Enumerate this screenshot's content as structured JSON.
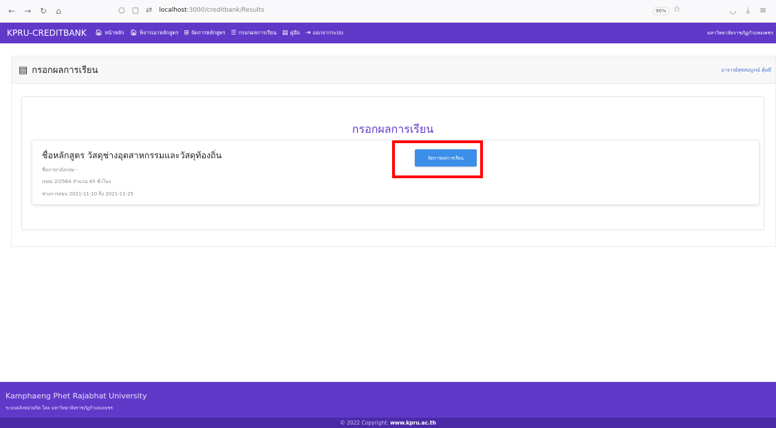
{
  "browser": {
    "url_host": "localhost",
    "url_path": ":3000/creditbank/Results",
    "zoom": "90%"
  },
  "navbar": {
    "brand": "KPRU-CREDITBANK",
    "items": [
      {
        "label": "หน้าหลัก",
        "icon": "home-icon"
      },
      {
        "label": "พิจารณาหลักสูตร",
        "icon": "home-icon"
      },
      {
        "label": "จัดการหลักสูตร",
        "icon": "plus-square-icon"
      },
      {
        "label": "กรอกผลการเรียน",
        "icon": "list-icon"
      },
      {
        "label": "คู่มือ",
        "icon": "book-icon"
      },
      {
        "label": "ออกจากระบบ",
        "icon": "sign-out-icon"
      }
    ],
    "university": "มหาวิทยาลัยราชภัฏกำแพงเพชร"
  },
  "page": {
    "title": "กรอกผลการเรียน",
    "user": "อาจารย์สุขสมบูรณ์ ตุ้มมี"
  },
  "card": {
    "title": "กรอกผลการเรียน",
    "course_name": "ชื่อหลักสูตร วัสดุช่างอุตสาหกรรมและวัสดุท้องถิ่น",
    "course_en": "ชื่อภาษาอังกฤษ -",
    "term": "เทอม 2/2564 จำนวน 45 ชั่วโมง",
    "period": "ช่วงการสอน 2021-11-10 ถึง 2021-11-25",
    "button_label": "จัดการผลการเรียน"
  },
  "footer": {
    "university": "Kamphaeng Phet Rajabhat University",
    "sub": "ระบบคลังหน่วยกิต โดย มหาวิทยาลัยราชภัฏกำแพงเพชร",
    "copyright_prefix": "© 2022 Copyright: ",
    "copyright_link": "www.kpru.ac.th"
  }
}
